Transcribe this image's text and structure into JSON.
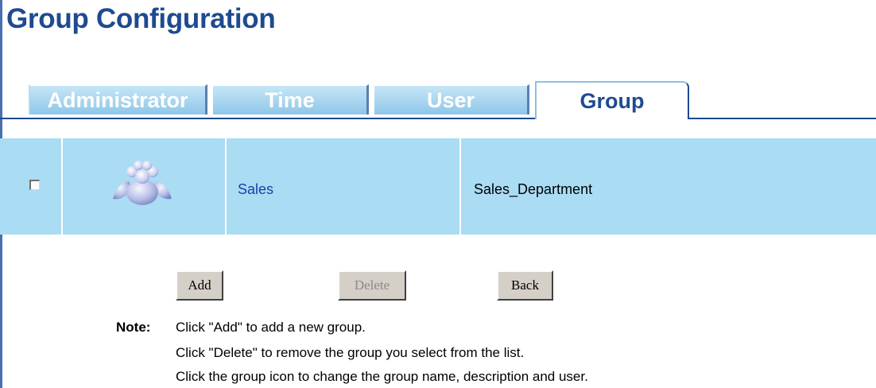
{
  "page": {
    "title": "Group Configuration"
  },
  "tabs": [
    {
      "label": "Administrator",
      "active": false
    },
    {
      "label": "Time",
      "active": false
    },
    {
      "label": "User",
      "active": false
    },
    {
      "label": "Group",
      "active": true
    }
  ],
  "groups": [
    {
      "checked": false,
      "icon": "group-people-icon",
      "name": "Sales",
      "description": "Sales_Department"
    }
  ],
  "buttons": {
    "add": "Add",
    "delete": "Delete",
    "back": "Back"
  },
  "note": {
    "label": "Note:",
    "lines": [
      "Click \"Add\" to add a new group.",
      "Click \"Delete\" to remove the group you select from the list.",
      "Click the group icon to change the group name, description and user."
    ]
  },
  "colors": {
    "title": "#1e4a90",
    "row_bg": "#aadcf4",
    "link": "#1a3fa8",
    "tab_bg": "#8fc6e8"
  }
}
